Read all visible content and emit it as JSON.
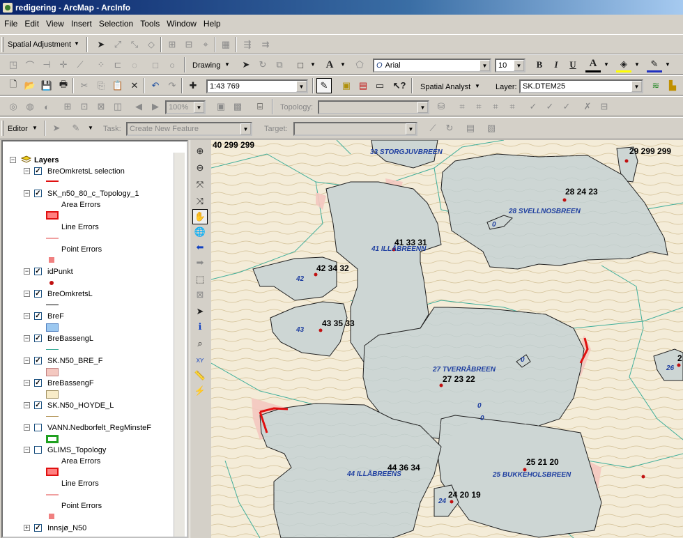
{
  "window": {
    "title": "redigering - ArcMap - ArcInfo"
  },
  "menu": [
    "File",
    "Edit",
    "View",
    "Insert",
    "Selection",
    "Tools",
    "Window",
    "Help"
  ],
  "toolbars": {
    "spatial_adjustment": "Spatial Adjustment",
    "drawing": "Drawing",
    "font": "Arial",
    "font_size": "10",
    "bold": "B",
    "italic": "I",
    "underline": "U",
    "text_tool": "A",
    "scale": "1:43 769",
    "spatial_analyst": "Spatial Analyst",
    "layer_label": "Layer:",
    "layer_value": "SK.DTEM25",
    "zoom_percent": "100%",
    "topology_label": "Topology:",
    "editor": "Editor",
    "task_label": "Task:",
    "task_value": "Create New Feature",
    "target_label": "Target:"
  },
  "toc": {
    "root": "Layers",
    "layers": [
      {
        "name": "BreOmkretsL selection",
        "checked": true,
        "symbol": "red-line"
      },
      {
        "name": "SK_n50_80_c_Topology_1",
        "checked": true,
        "sub": [
          {
            "label": "Area Errors",
            "symbol": "red-box"
          },
          {
            "label": "Line Errors",
            "symbol": "pink-line"
          },
          {
            "label": "Point Errors",
            "symbol": "pink-square"
          }
        ]
      },
      {
        "name": "idPunkt",
        "checked": true,
        "symbol": "red-dot"
      },
      {
        "name": "BreOmkretsL",
        "checked": true,
        "symbol": "black-line"
      },
      {
        "name": "BreF",
        "checked": true,
        "symbol": "blue-box"
      },
      {
        "name": "BreBassengL",
        "checked": true,
        "symbol": "teal-line"
      },
      {
        "name": "SK.N50_BRE_F",
        "checked": true,
        "symbol": "pink-box"
      },
      {
        "name": "BreBassengF",
        "checked": true,
        "symbol": "cream-box"
      },
      {
        "name": "SK.N50_HOYDE_L",
        "checked": true,
        "symbol": "tan-line"
      },
      {
        "name": "VANN.Nedborfelt_RegMinsteF",
        "checked": false,
        "symbol": "green-box"
      },
      {
        "name": "GLIMS_Topology",
        "checked": false,
        "sub": [
          {
            "label": "Area Errors",
            "symbol": "red-box"
          },
          {
            "label": "Line Errors",
            "symbol": "pink-line"
          },
          {
            "label": "Point Errors",
            "symbol": "pink-square"
          }
        ]
      },
      {
        "name": "Innsjø_N50",
        "checked": true
      }
    ]
  },
  "map": {
    "labels": [
      {
        "id": "40",
        "text": "40  299  299"
      },
      {
        "id": "33g",
        "text": "33  STORGJUVBREEN"
      },
      {
        "id": "29",
        "text": "29  299  299"
      },
      {
        "id": "28n",
        "text": "28  24  23"
      },
      {
        "id": "28g",
        "text": "28  SVELLNOSBREEN"
      },
      {
        "id": "41n",
        "text": "41  33  31"
      },
      {
        "id": "41g",
        "text": "41  ILLÅBREENN"
      },
      {
        "id": "42n",
        "text": "42  34  32"
      },
      {
        "id": "42g",
        "text": "42"
      },
      {
        "id": "43n",
        "text": "43  35  33"
      },
      {
        "id": "43g",
        "text": "43"
      },
      {
        "id": "27n",
        "text": "27  23  22"
      },
      {
        "id": "27g",
        "text": "27  TVERRÅBREEN"
      },
      {
        "id": "44n",
        "text": "44  36  34"
      },
      {
        "id": "44g",
        "text": "44  ILLÅBREENS"
      },
      {
        "id": "25n",
        "text": "25  21  20"
      },
      {
        "id": "25g",
        "text": "25  BUKKEHOLSBREEN"
      },
      {
        "id": "24n",
        "text": "24  20  19"
      },
      {
        "id": "24g",
        "text": "24"
      },
      {
        "id": "26g",
        "text": "26"
      },
      {
        "id": "2x",
        "text": "2"
      }
    ],
    "small_zero": "0"
  },
  "colors": {
    "glacier": "#cdd6d4",
    "terrain": "#f4ecd8",
    "contour": "#c9b98a",
    "basin": "#3fae9a",
    "error": "#e01010",
    "label_blue": "#1f3fa0"
  }
}
